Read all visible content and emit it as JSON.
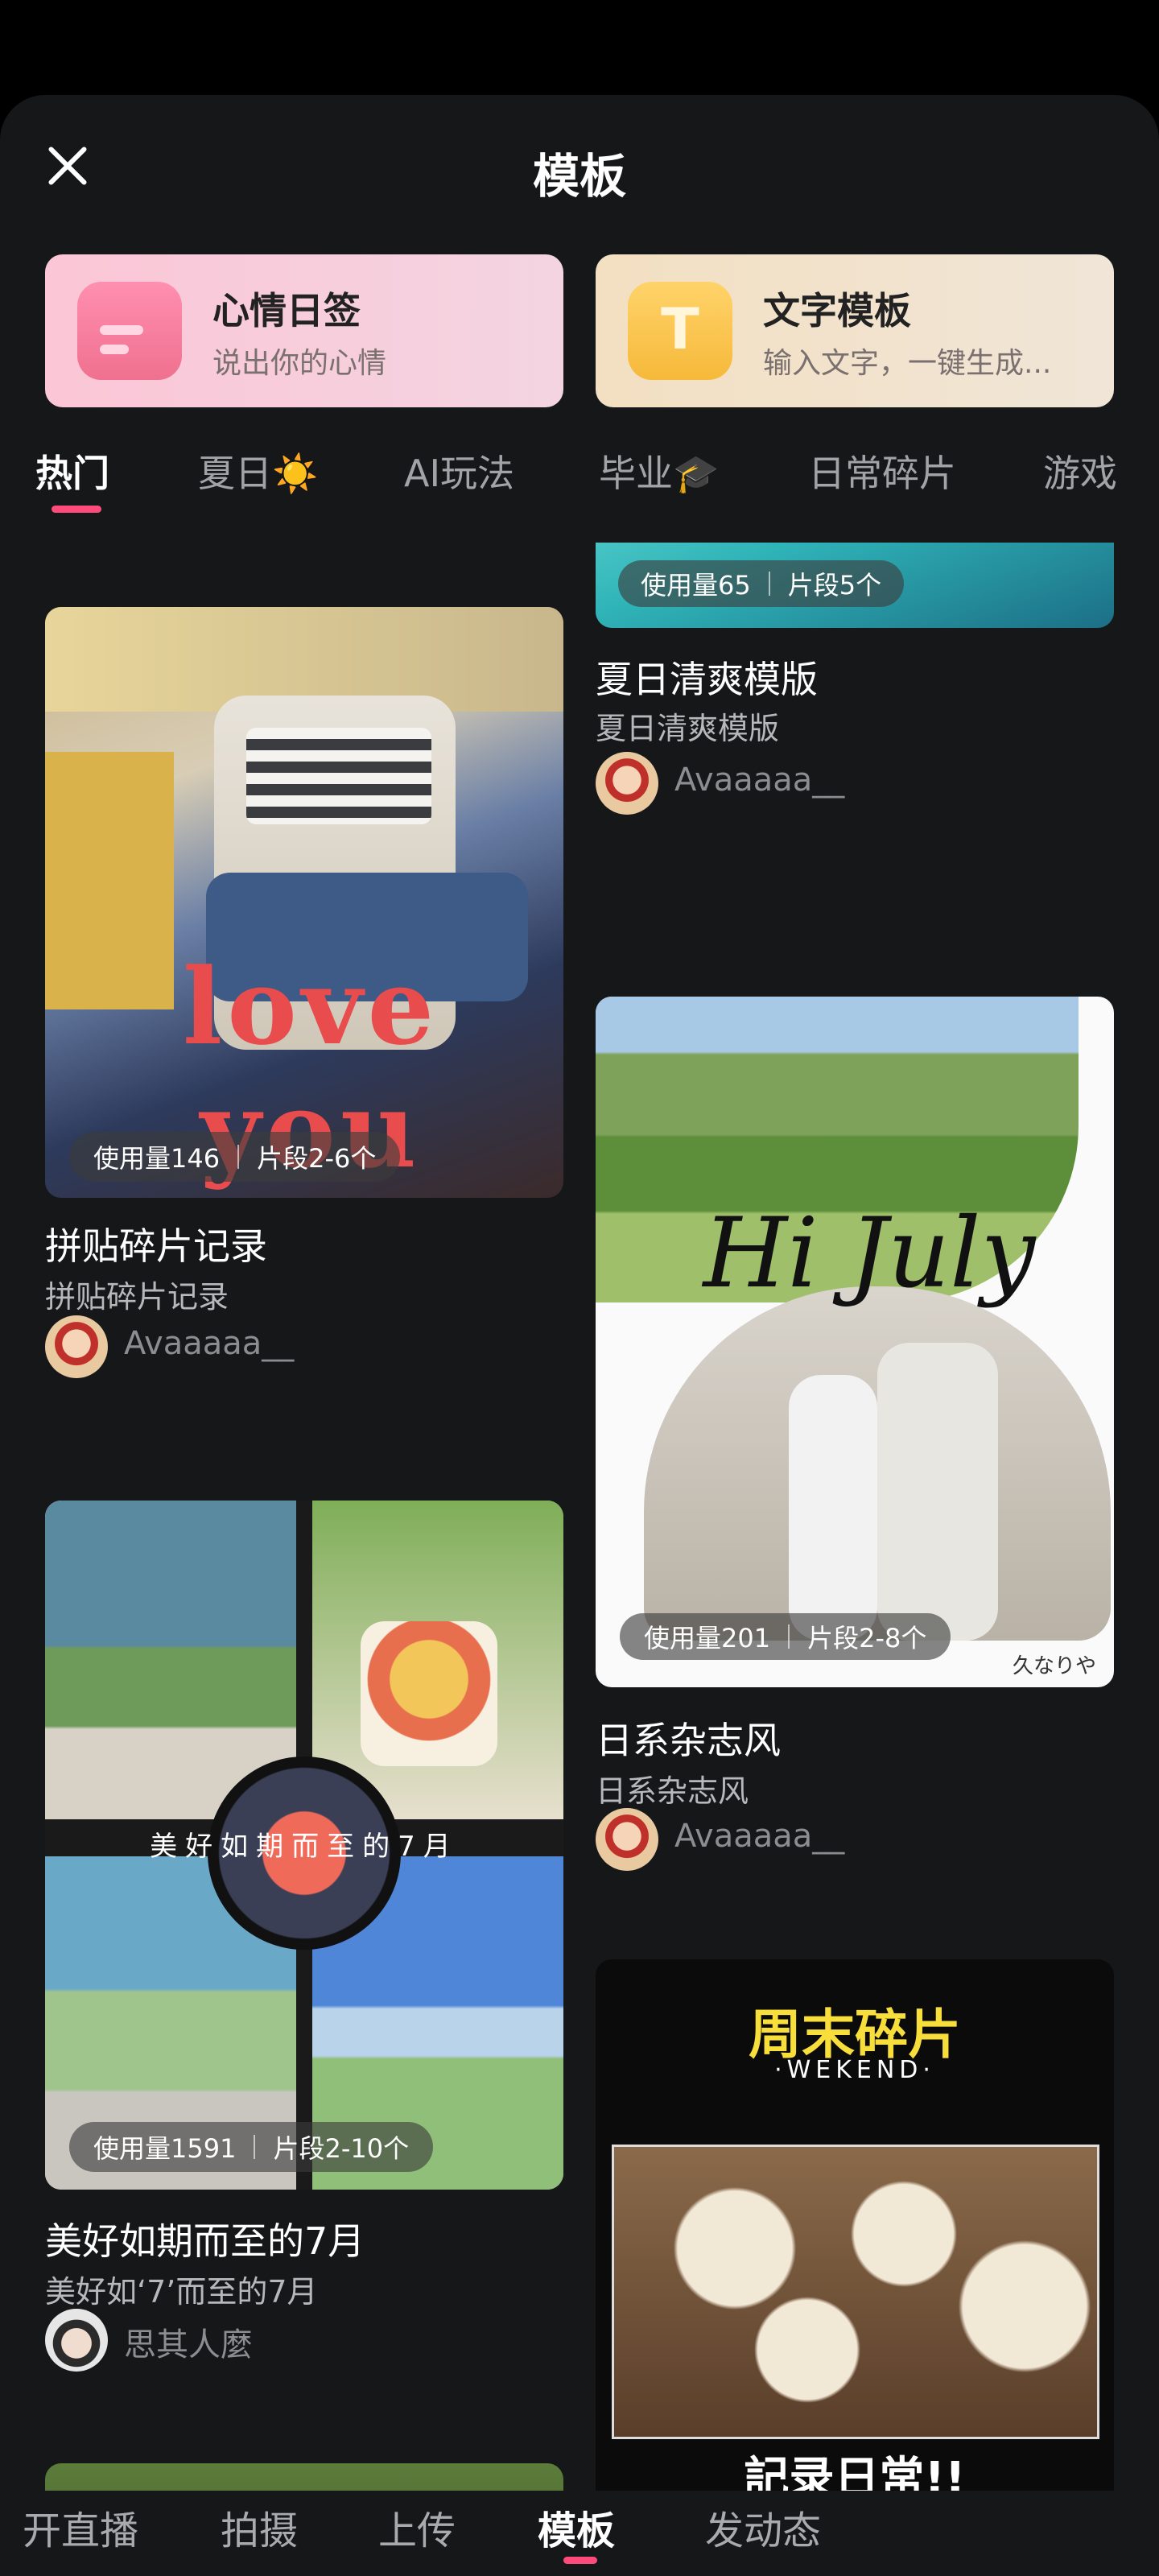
{
  "header": {
    "title": "模板"
  },
  "quick_cards": [
    {
      "title": "心情日签",
      "subtitle": "说出你的心情"
    },
    {
      "title": "文字模板",
      "subtitle": "输入文字，一键生成...",
      "icon_glyph": "T"
    }
  ],
  "tabs": [
    {
      "label": "热门"
    },
    {
      "label": "夏日☀️"
    },
    {
      "label": "AI玩法"
    },
    {
      "label": "毕业🎓"
    },
    {
      "label": "日常碎片"
    },
    {
      "label": "游戏"
    }
  ],
  "templates": [
    {
      "usage": "使用量146",
      "segments": "片段2-6个",
      "title": "拼贴碎片记录",
      "subtitle": "拼贴碎片记录",
      "author": "Avaaaaa__",
      "thumb_text": "love you"
    },
    {
      "usage": "使用量1591",
      "segments": "片段2-10个",
      "title": "美好如期而至的7月",
      "subtitle": "美好如‘7’而至的7月",
      "author": "思其人麼",
      "thumb_text": "美好如期而至的7月"
    },
    {
      "usage": "使用量65",
      "segments": "片段5个",
      "title": "夏日清爽模版",
      "subtitle": "夏日清爽模版",
      "author": "Avaaaaa__"
    },
    {
      "usage": "使用量201",
      "segments": "片段2-8个",
      "title": "日系杂志风",
      "subtitle": "日系杂志风",
      "author": "Avaaaaa__",
      "thumb_text": "Hi July",
      "thumb_caption": "久なりや"
    },
    {
      "thumb_title": "周末碎片",
      "thumb_subtitle": "·WEKEND·",
      "thumb_footer": "記录日常!!"
    }
  ],
  "bottom_nav": [
    {
      "label": "开直播"
    },
    {
      "label": "拍摄"
    },
    {
      "label": "上传"
    },
    {
      "label": "模板"
    },
    {
      "label": "发动态"
    }
  ],
  "colors": {
    "accent": "#ff4b7c",
    "background": "#161719"
  }
}
